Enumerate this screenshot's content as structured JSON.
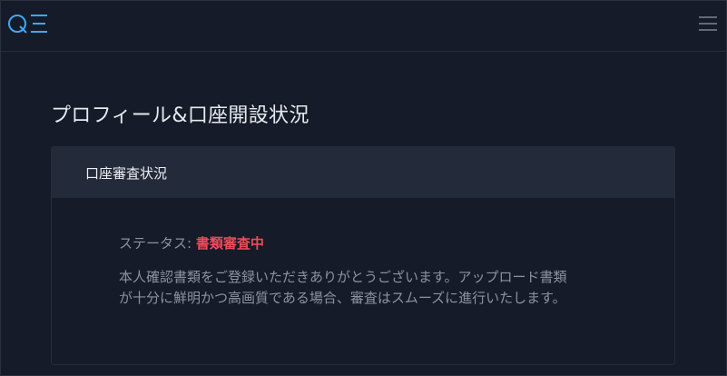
{
  "header": {
    "logo_icon": "qe-logo-icon",
    "menu_icon": "hamburger-menu-icon",
    "accent_color": "#3fa8f4"
  },
  "page": {
    "title": "プロフィール&口座開設状況"
  },
  "review_card": {
    "title": "口座審査状況",
    "status_label": "ステータス: ",
    "status_value": "書類審査中",
    "status_color": "#ef4b5a",
    "description_line1": "本人確認書類をご登録いただきありがとうございます。アップロード書類",
    "description_line2": "が十分に鮮明かつ高画質である場合、審査はスムーズに進行いたします。"
  }
}
